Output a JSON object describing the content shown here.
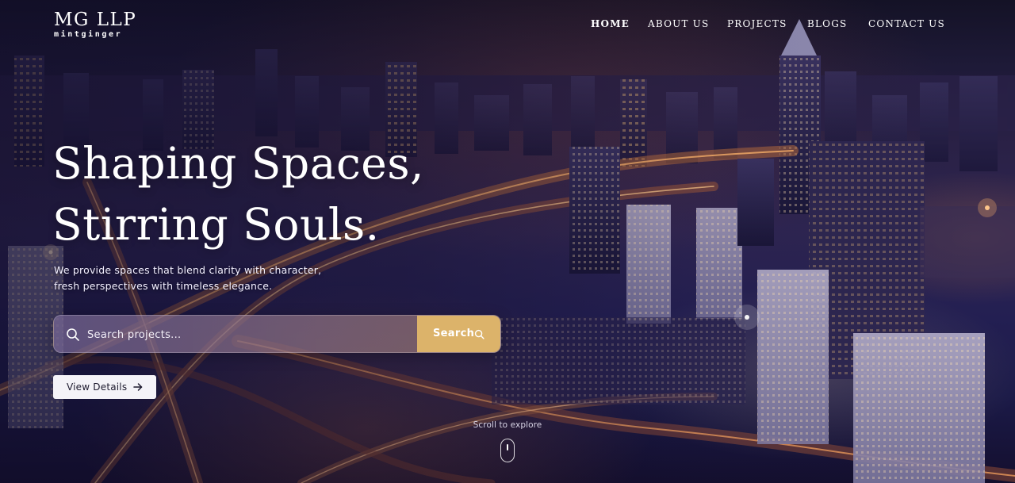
{
  "brand": {
    "title": "MG LLP",
    "subtitle": "mintginger"
  },
  "nav": {
    "items": [
      {
        "label": "HOME",
        "active": true
      },
      {
        "label": "ABOUT US",
        "active": false
      },
      {
        "label": "PROJECTS",
        "active": false
      },
      {
        "label": "BLOGS",
        "active": false
      },
      {
        "label": "CONTACT US",
        "active": false
      }
    ]
  },
  "hero": {
    "headline_line1": "Shaping Spaces,",
    "headline_line2": "Stirring Souls.",
    "tagline_line1": "We provide spaces that blend clarity with character,",
    "tagline_line2": "fresh perspectives with timeless elegance."
  },
  "search": {
    "placeholder": "Search projects...",
    "value": "",
    "button_label": "Search",
    "icon": "search-icon"
  },
  "details": {
    "button_label": "View Details",
    "icon": "arrow-right-icon"
  },
  "scroll": {
    "label": "Scroll to explore",
    "icon": "mouse-icon"
  },
  "colors": {
    "accent": "#dcb36a",
    "background": "#1b1a48",
    "text": "#ffffff"
  }
}
